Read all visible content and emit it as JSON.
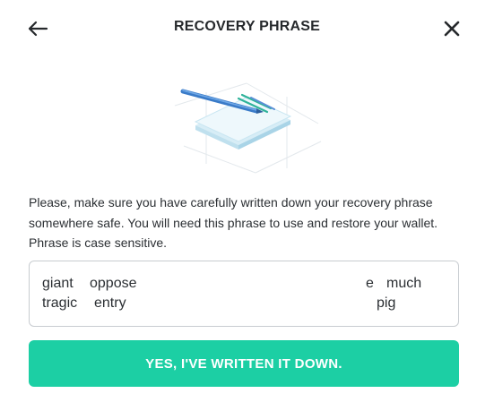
{
  "header": {
    "title": "RECOVERY PHRASE",
    "back_icon": "arrow-left-icon",
    "close_icon": "close-icon"
  },
  "illustration": {
    "icon": "notebook-with-pen-icon"
  },
  "description": "Please, make sure you have carefully written down your recovery phrase somewhere safe. You will need this phrase to use and restore your wallet. Phrase is case sensitive.",
  "phrase": {
    "words": [
      "giant",
      "oppose",
      "e",
      "much",
      "tragic",
      "entry",
      "pig"
    ]
  },
  "confirm_button": {
    "label": "YES, I'VE WRITTEN IT DOWN."
  },
  "colors": {
    "accent": "#1ccfa4",
    "text": "#2b2f33",
    "border": "#c8ccd0"
  }
}
